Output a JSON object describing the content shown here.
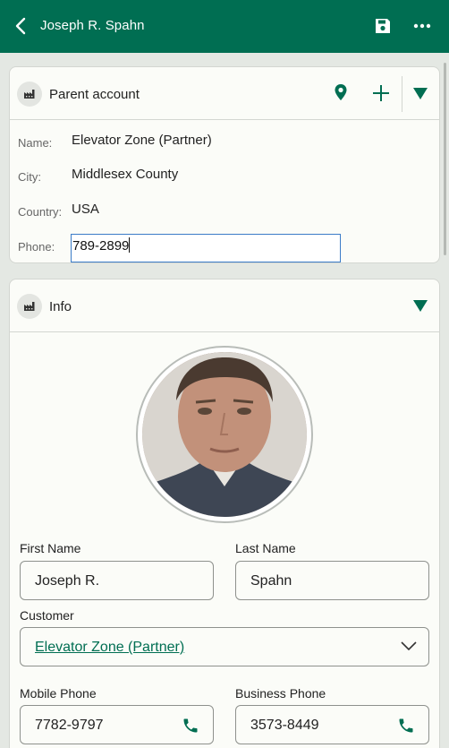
{
  "header": {
    "title": "Joseph R. Spahn",
    "back_icon": "chevron-left-icon",
    "save_icon": "save-icon",
    "more_icon": "more-horizontal-icon",
    "bg_color": "#006e52"
  },
  "parent_account": {
    "title": "Parent account",
    "icon": "factory-icon",
    "actions": [
      "location-pin-icon",
      "plus-icon",
      "chevron-down-icon"
    ],
    "rows": [
      {
        "label": "Name:",
        "value": "Elevator Zone (Partner)"
      },
      {
        "label": "City:",
        "value": "Middlesex County"
      },
      {
        "label": "Country:",
        "value": "USA"
      }
    ],
    "phone": {
      "label": "Phone:",
      "value": "789-2899"
    }
  },
  "info": {
    "title": "Info",
    "icon": "factory-icon",
    "collapse_icon": "chevron-down-icon",
    "avatar": "profile-photo",
    "first_name": {
      "label": "First Name",
      "value": "Joseph R."
    },
    "last_name": {
      "label": "Last Name",
      "value": "Spahn"
    },
    "customer": {
      "label": "Customer",
      "value": "Elevator Zone (Partner)"
    },
    "mobile_phone": {
      "label": "Mobile Phone",
      "value": "7782-9797"
    },
    "business_phone": {
      "label": "Business Phone",
      "value": "3573-8449"
    }
  },
  "colors": {
    "accent": "#006e52",
    "focus_border": "#3b7cc8"
  }
}
